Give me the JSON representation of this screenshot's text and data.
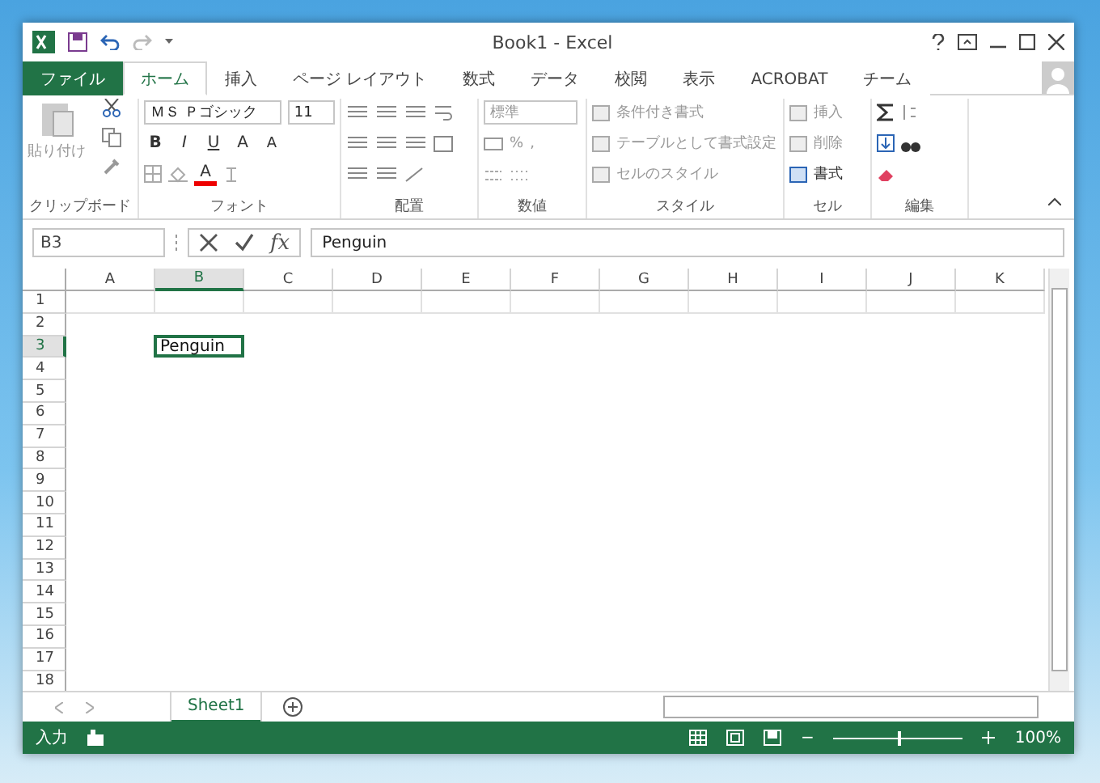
{
  "window": {
    "title": "Book1 - Excel"
  },
  "tabs": [
    {
      "label": "ファイル",
      "kind": "file",
      "selected": false
    },
    {
      "label": "ホーム",
      "kind": "tab",
      "selected": true
    },
    {
      "label": "挿入",
      "kind": "tab",
      "selected": false
    },
    {
      "label": "ページ レイアウト",
      "kind": "tab",
      "selected": false
    },
    {
      "label": "数式",
      "kind": "tab",
      "selected": false
    },
    {
      "label": "データ",
      "kind": "tab",
      "selected": false
    },
    {
      "label": "校閲",
      "kind": "tab",
      "selected": false
    },
    {
      "label": "表示",
      "kind": "tab",
      "selected": false
    },
    {
      "label": "ACROBAT",
      "kind": "tab",
      "selected": false
    },
    {
      "label": "チーム",
      "kind": "tab",
      "selected": false
    }
  ],
  "ribbon": {
    "clipboard": {
      "label": "クリップボード",
      "paste": "貼り付け"
    },
    "font": {
      "label": "フォント",
      "name": "ＭＳ Ｐゴシック",
      "size": "11",
      "bold": "B",
      "italic": "I",
      "underline": "U",
      "grow": "A",
      "shrink": "A",
      "font_color_button": "A"
    },
    "alignment": {
      "label": "配置"
    },
    "number": {
      "label": "数値",
      "format": "標準",
      "percent": "%",
      "comma": ","
    },
    "styles": {
      "label": "スタイル",
      "items": [
        "条件付き書式",
        "テーブルとして書式設定",
        "セルのスタイル"
      ]
    },
    "cells": {
      "label": "セル",
      "items": [
        {
          "label": "挿入",
          "disabled": true
        },
        {
          "label": "削除",
          "disabled": true
        },
        {
          "label": "書式",
          "disabled": false
        }
      ]
    },
    "editing": {
      "label": "編集"
    }
  },
  "formula_bar": {
    "name_box": "B3",
    "fx": "fx",
    "value": "Penguin"
  },
  "sheet": {
    "columns": [
      {
        "label": "A",
        "selected": false
      },
      {
        "label": "B",
        "selected": true
      },
      {
        "label": "C",
        "selected": false
      },
      {
        "label": "D",
        "selected": false
      },
      {
        "label": "E",
        "selected": false
      },
      {
        "label": "F",
        "selected": false
      },
      {
        "label": "G",
        "selected": false
      },
      {
        "label": "H",
        "selected": false
      },
      {
        "label": "I",
        "selected": false
      },
      {
        "label": "J",
        "selected": false
      },
      {
        "label": "K",
        "selected": false
      }
    ],
    "rows": [
      {
        "label": "1",
        "selected": false
      },
      {
        "label": "2",
        "selected": false
      },
      {
        "label": "3",
        "selected": true
      },
      {
        "label": "4",
        "selected": false
      },
      {
        "label": "5",
        "selected": false
      },
      {
        "label": "6",
        "selected": false
      },
      {
        "label": "7",
        "selected": false
      },
      {
        "label": "8",
        "selected": false
      },
      {
        "label": "9",
        "selected": false
      },
      {
        "label": "10",
        "selected": false
      },
      {
        "label": "11",
        "selected": false
      },
      {
        "label": "12",
        "selected": false
      },
      {
        "label": "13",
        "selected": false
      },
      {
        "label": "14",
        "selected": false
      },
      {
        "label": "15",
        "selected": false
      },
      {
        "label": "16",
        "selected": false
      },
      {
        "label": "17",
        "selected": false
      },
      {
        "label": "18",
        "selected": false
      }
    ],
    "active_cell": {
      "value": "Penguin"
    }
  },
  "sheet_tabs": [
    {
      "label": "Sheet1",
      "selected": true
    }
  ],
  "status_bar": {
    "mode": "入力",
    "zoom_out": "−",
    "zoom": "100%",
    "level": 0.5
  }
}
